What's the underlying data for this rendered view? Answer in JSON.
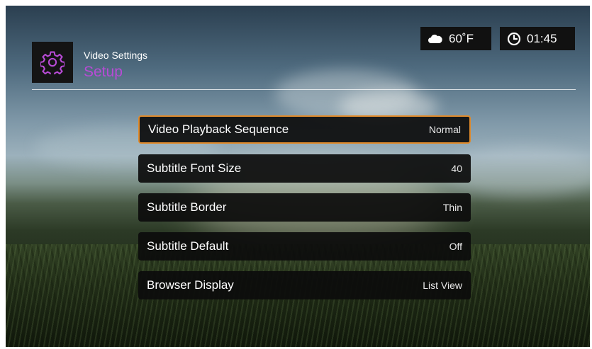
{
  "header": {
    "subtitle": "Video Settings",
    "title": "Setup",
    "icon": "gear-icon",
    "title_color": "#b84bd6"
  },
  "status": {
    "weather_icon": "cloud-icon",
    "temperature": "60˚F",
    "clock_icon": "clock-icon",
    "time": "01:45"
  },
  "menu": {
    "selected_index": 0,
    "selected_border_color": "#e08a2a",
    "items": [
      {
        "label": "Video Playback Sequence",
        "value": "Normal"
      },
      {
        "label": "Subtitle Font Size",
        "value": "40"
      },
      {
        "label": "Subtitle Border",
        "value": "Thin"
      },
      {
        "label": "Subtitle Default",
        "value": "Off"
      },
      {
        "label": "Browser Display",
        "value": "List View"
      }
    ]
  }
}
